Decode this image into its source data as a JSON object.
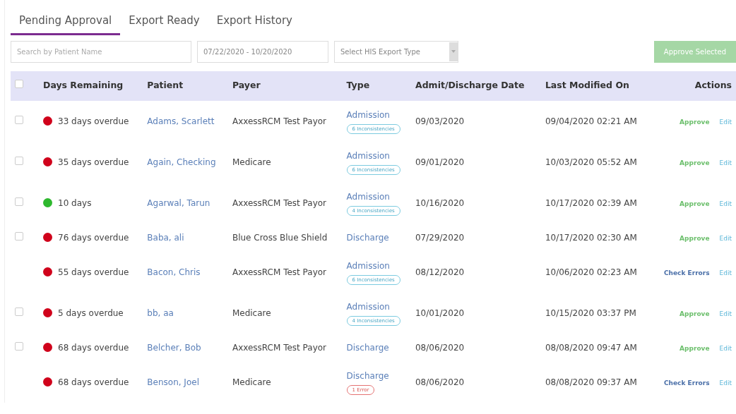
{
  "tabs": [
    {
      "label": "Pending Approval",
      "selected": true
    },
    {
      "label": "Export Ready",
      "selected": false
    },
    {
      "label": "Export History",
      "selected": false
    }
  ],
  "filters": {
    "search": {
      "placeholder": "Search by Patient Name"
    },
    "date_range": {
      "value": "07/22/2020 - 10/20/2020"
    },
    "export_type": {
      "placeholder": "Select HIS Export Type"
    }
  },
  "approve_selected": {
    "label": "Approve Selected",
    "disabled": true
  },
  "table": {
    "select_all": {
      "checked": false
    },
    "columns": [
      "Days Remaining",
      "Patient",
      "Payer",
      "Type",
      "Admit/Discharge Date",
      "Last Modified On",
      "Actions"
    ],
    "rows": [
      {
        "selectable": true,
        "checked": false,
        "color": "#d0021b",
        "days": "33 days overdue",
        "patient": "Adams, Scarlett",
        "payer": "AxxessRCM Test Payor",
        "type": "Admission",
        "badge": {
          "kind": "info",
          "label": "6 Inconsistencies"
        },
        "date": "09/03/2020",
        "modified": "09/04/2020 02:21 AM",
        "action": {
          "kind": "approve",
          "label": "Approve"
        },
        "edit": "Edit"
      },
      {
        "selectable": true,
        "checked": false,
        "color": "#d0021b",
        "days": "35 days overdue",
        "patient": "Again, Checking",
        "payer": "Medicare",
        "type": "Admission",
        "badge": {
          "kind": "info",
          "label": "6 Inconsistencies"
        },
        "date": "09/01/2020",
        "modified": "10/03/2020 05:52 AM",
        "action": {
          "kind": "approve",
          "label": "Approve"
        },
        "edit": "Edit"
      },
      {
        "selectable": true,
        "checked": false,
        "color": "#2eb82e",
        "days": "10 days",
        "patient": "Agarwal, Tarun",
        "payer": "AxxessRCM Test Payor",
        "type": "Admission",
        "badge": {
          "kind": "info",
          "label": "4 Inconsistencies"
        },
        "date": "10/16/2020",
        "modified": "10/17/2020 02:39 AM",
        "action": {
          "kind": "approve",
          "label": "Approve"
        },
        "edit": "Edit"
      },
      {
        "selectable": true,
        "checked": false,
        "color": "#d0021b",
        "days": "76 days overdue",
        "patient": "Baba, ali",
        "payer": "Blue Cross Blue Shield",
        "type": "Discharge",
        "date": "07/29/2020",
        "modified": "10/17/2020 02:30 AM",
        "action": {
          "kind": "approve",
          "label": "Approve"
        },
        "edit": "Edit"
      },
      {
        "selectable": false,
        "color": "#d0021b",
        "days": "55 days overdue",
        "patient": "Bacon, Chris",
        "payer": "AxxessRCM Test Payor",
        "type": "Admission",
        "badge": {
          "kind": "info",
          "label": "6 Inconsistencies"
        },
        "date": "08/12/2020",
        "modified": "10/06/2020 02:23 AM",
        "action": {
          "kind": "check_errors",
          "label": "Check Errors"
        },
        "edit": "Edit"
      },
      {
        "selectable": true,
        "checked": false,
        "color": "#d0021b",
        "days": "5 days overdue",
        "patient": "bb, aa",
        "payer": "Medicare",
        "type": "Admission",
        "badge": {
          "kind": "info",
          "label": "4 Inconsistencies"
        },
        "date": "10/01/2020",
        "modified": "10/15/2020 03:37 PM",
        "action": {
          "kind": "approve",
          "label": "Approve"
        },
        "edit": "Edit"
      },
      {
        "selectable": true,
        "checked": false,
        "color": "#d0021b",
        "days": "68 days overdue",
        "patient": "Belcher, Bob",
        "payer": "AxxessRCM Test Payor",
        "type": "Discharge",
        "date": "08/06/2020",
        "modified": "08/08/2020 09:47 AM",
        "action": {
          "kind": "approve",
          "label": "Approve"
        },
        "edit": "Edit"
      },
      {
        "selectable": false,
        "color": "#d0021b",
        "days": "68 days overdue",
        "patient": "Benson, Joel",
        "payer": "Medicare",
        "type": "Discharge",
        "badge": {
          "kind": "error",
          "label": "1 Error"
        },
        "date": "08/06/2020",
        "modified": "08/08/2020 09:37 AM",
        "action": {
          "kind": "check_errors",
          "label": "Check Errors"
        },
        "edit": "Edit"
      }
    ]
  }
}
